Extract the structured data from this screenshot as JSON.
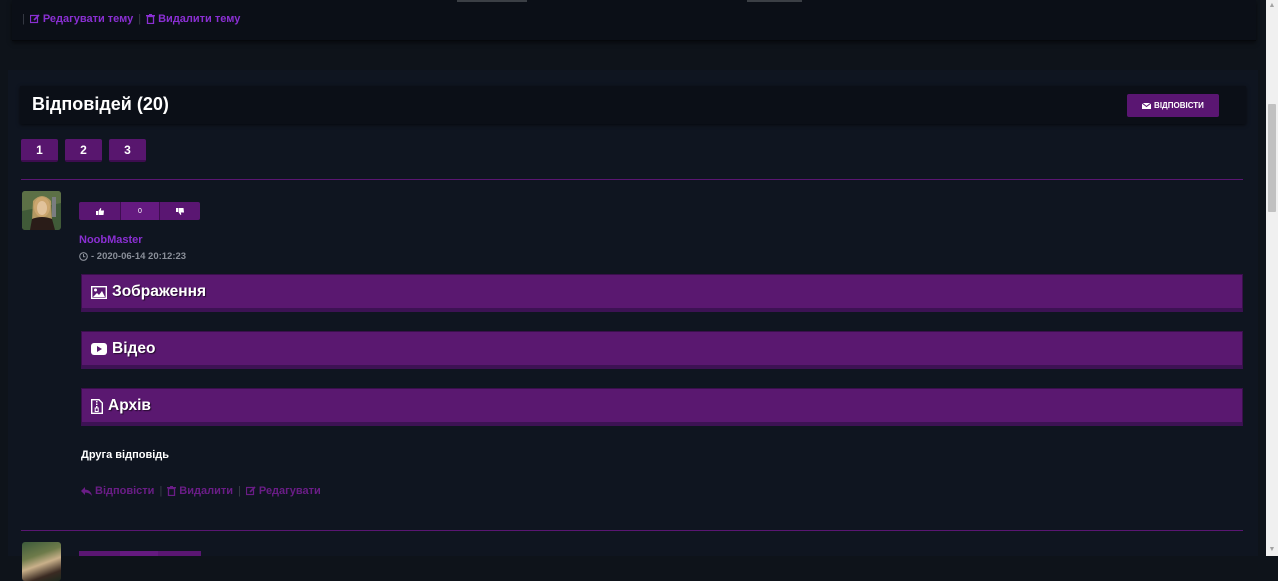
{
  "topic_actions": {
    "separator": "|",
    "edit_label": "Редагувати тему",
    "delete_label": "Видалити тему"
  },
  "replies_header": {
    "title": "Відповідей (20)",
    "reply_button": "ВІДПОВІСТИ"
  },
  "pagination": [
    "1",
    "2",
    "3"
  ],
  "post": {
    "votes": {
      "count": "0"
    },
    "username": "NoobMaster",
    "date": "- 2020-06-14 20:12:23",
    "sections": [
      {
        "label": "Зображення",
        "icon": "image-icon"
      },
      {
        "label": "Відео",
        "icon": "youtube-icon"
      },
      {
        "label": "Архів",
        "icon": "archive-file-icon"
      }
    ],
    "text": "Друга відповідь",
    "actions": {
      "reply": "Відповісти",
      "delete": "Видалити",
      "edit": "Редагувати",
      "separator": "|"
    }
  },
  "colors": {
    "background": "#0e131a",
    "panel": "#0b0f17",
    "accent": "#5a1672",
    "link": "#8a2fd2"
  }
}
